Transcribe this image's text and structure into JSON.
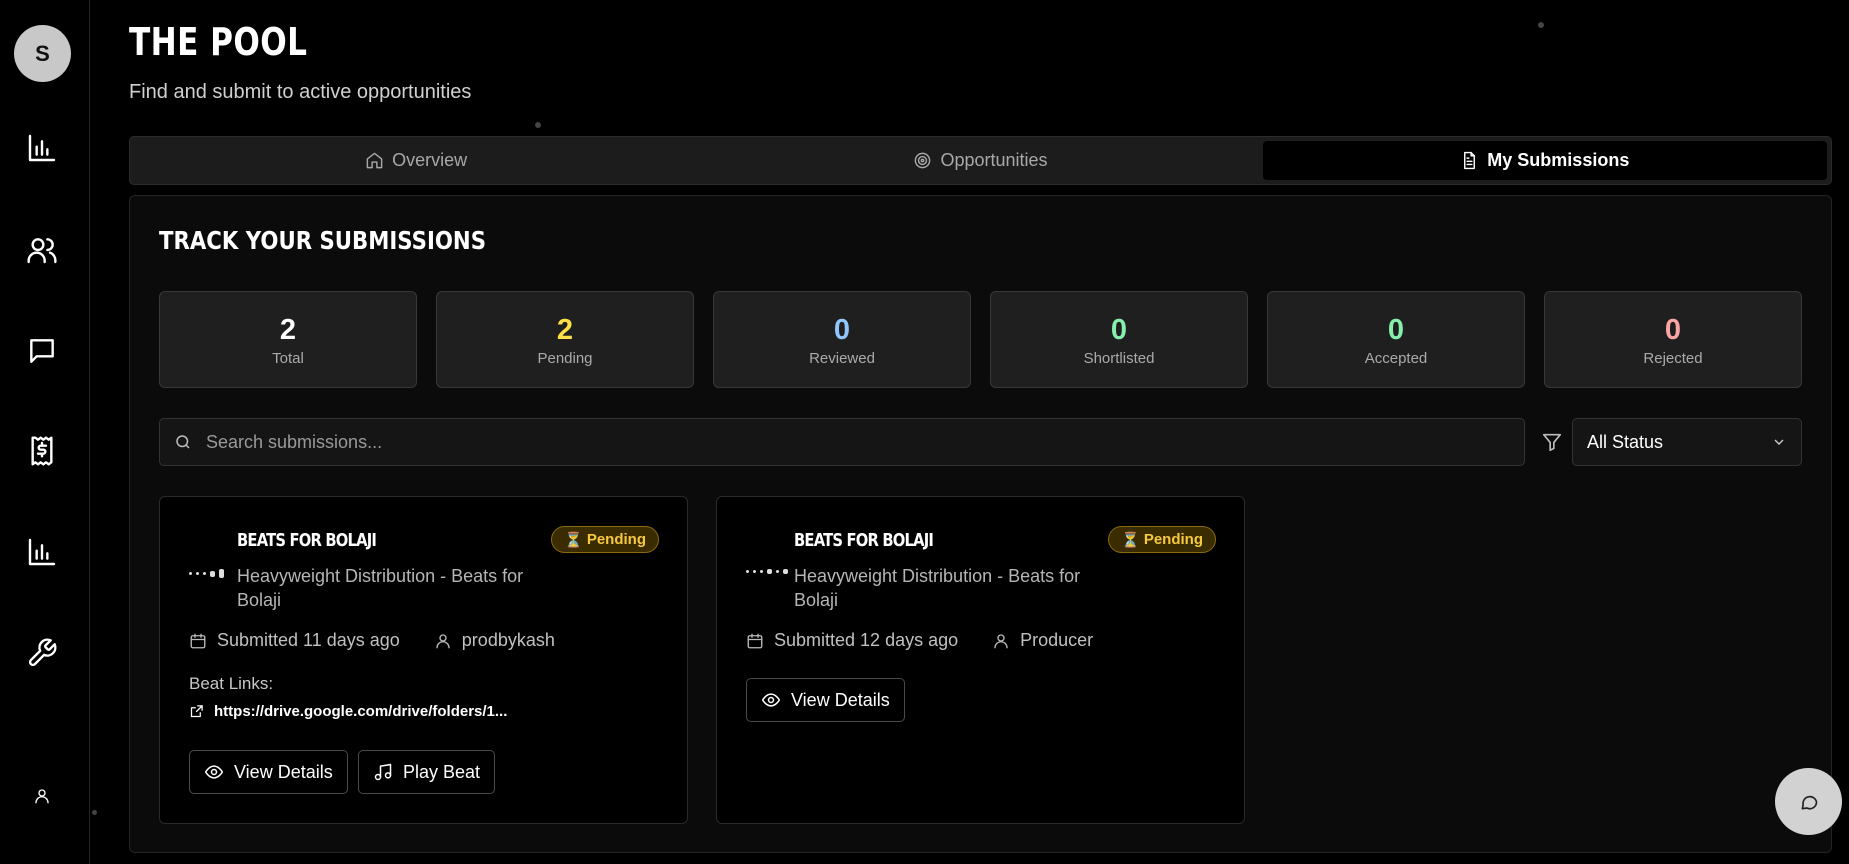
{
  "user": {
    "avatar_initial": "S"
  },
  "sidebar": {
    "items": [
      {
        "icon": "bar-chart-icon"
      },
      {
        "icon": "users-icon"
      },
      {
        "icon": "message-square-icon"
      },
      {
        "icon": "receipt-dollar-icon"
      },
      {
        "icon": "bar-chart-icon"
      },
      {
        "icon": "wrench-icon"
      }
    ],
    "profile_icon": "user-icon"
  },
  "header": {
    "title": "THE POOL",
    "subtitle": "Find and submit to active opportunities"
  },
  "tabs": [
    {
      "label": "Overview",
      "icon": "home-icon",
      "active": false
    },
    {
      "label": "Opportunities",
      "icon": "target-icon",
      "active": false
    },
    {
      "label": "My Submissions",
      "icon": "file-text-icon",
      "active": true
    }
  ],
  "section": {
    "title": "TRACK YOUR SUBMISSIONS"
  },
  "stats": [
    {
      "value": "2",
      "label": "Total",
      "color": "#ffffff"
    },
    {
      "value": "2",
      "label": "Pending",
      "color": "#fde047"
    },
    {
      "value": "0",
      "label": "Reviewed",
      "color": "#93c5fd"
    },
    {
      "value": "0",
      "label": "Shortlisted",
      "color": "#86efac"
    },
    {
      "value": "0",
      "label": "Accepted",
      "color": "#86efac"
    },
    {
      "value": "0",
      "label": "Rejected",
      "color": "#fca5a5"
    }
  ],
  "search": {
    "placeholder": "Search submissions...",
    "value": ""
  },
  "filter": {
    "selected": "All Status"
  },
  "submissions": [
    {
      "title": "BEATS FOR BOLAJI",
      "status": "Pending",
      "status_icon": "⏳",
      "description": "Heavyweight Distribution - Beats for Bolaji",
      "submitted": "Submitted 11 days ago",
      "producer": "prodbykash",
      "links_label": "Beat Links:",
      "link": "https://drive.google.com/drive/folders/1...",
      "view_label": "View Details",
      "play_label": "Play Beat"
    },
    {
      "title": "BEATS FOR BOLAJI",
      "status": "Pending",
      "status_icon": "⏳",
      "description": "Heavyweight Distribution - Beats for Bolaji",
      "submitted": "Submitted 12 days ago",
      "producer": "Producer",
      "view_label": "View Details"
    }
  ],
  "chat": {
    "icon": "chat-bubble-icon"
  }
}
